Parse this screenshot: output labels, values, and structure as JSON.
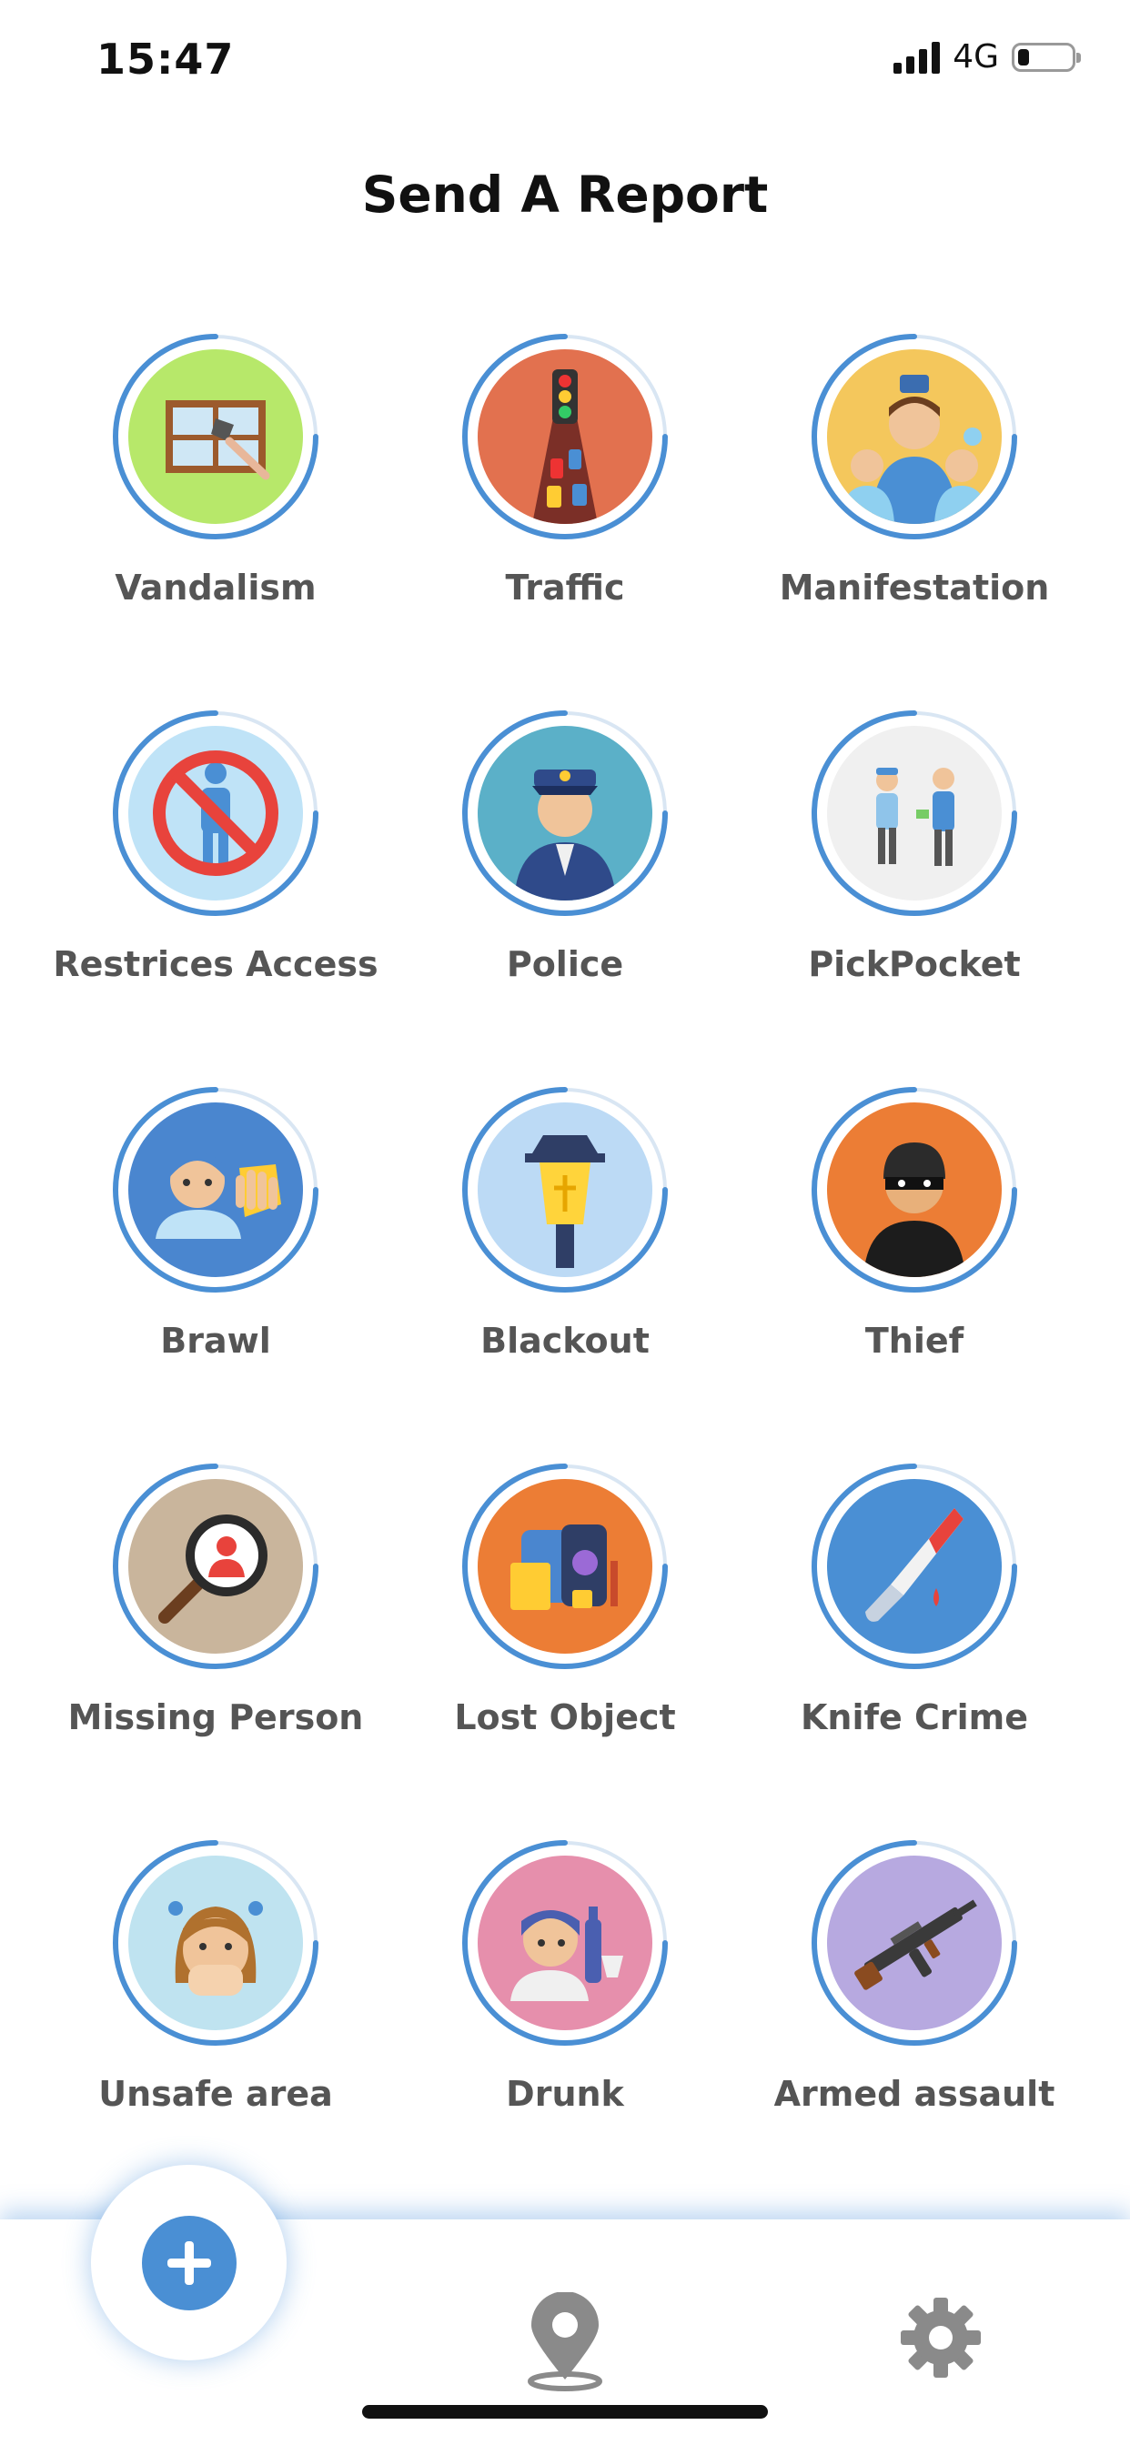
{
  "status_bar": {
    "time": "15:47",
    "network": "4G"
  },
  "header": {
    "title": "Send A Report"
  },
  "report_types": [
    {
      "label": "Vandalism",
      "icon": "vandalism-icon",
      "bg": "#b7e86a"
    },
    {
      "label": "Traffic",
      "icon": "traffic-icon",
      "bg": "#e2714f"
    },
    {
      "label": "Manifestation",
      "icon": "manifestation-icon",
      "bg": "#f4c75c"
    },
    {
      "label": "Restrices Access",
      "icon": "restricted-access-icon",
      "bg": "#bfe3f7"
    },
    {
      "label": "Police",
      "icon": "police-icon",
      "bg": "#5bb0c8"
    },
    {
      "label": "PickPocket",
      "icon": "pickpocket-icon",
      "bg": "#f0f0f0"
    },
    {
      "label": "Brawl",
      "icon": "brawl-icon",
      "bg": "#4a86cf"
    },
    {
      "label": "Blackout",
      "icon": "blackout-icon",
      "bg": "#bcdaf5"
    },
    {
      "label": "Thief",
      "icon": "thief-icon",
      "bg": "#ec7d35"
    },
    {
      "label": "Missing Person",
      "icon": "missing-person-icon",
      "bg": "#c9b59c"
    },
    {
      "label": "Lost Object",
      "icon": "lost-object-icon",
      "bg": "#ec7d35"
    },
    {
      "label": "Knife Crime",
      "icon": "knife-crime-icon",
      "bg": "#4a8fd4"
    },
    {
      "label": "Unsafe area",
      "icon": "unsafe-area-icon",
      "bg": "#bfe3f0"
    },
    {
      "label": "Drunk",
      "icon": "drunk-icon",
      "bg": "#e68fac"
    },
    {
      "label": "Armed assault",
      "icon": "armed-assault-icon",
      "bg": "#b7a9e0"
    }
  ],
  "bottom_nav": {
    "items": [
      {
        "name": "add-report",
        "icon": "plus-icon"
      },
      {
        "name": "map",
        "icon": "location-pin-icon"
      },
      {
        "name": "settings",
        "icon": "gear-icon"
      }
    ]
  },
  "colors": {
    "accent": "#4a8fd4",
    "label": "#555555",
    "nav_icon": "#8a8a8a"
  }
}
